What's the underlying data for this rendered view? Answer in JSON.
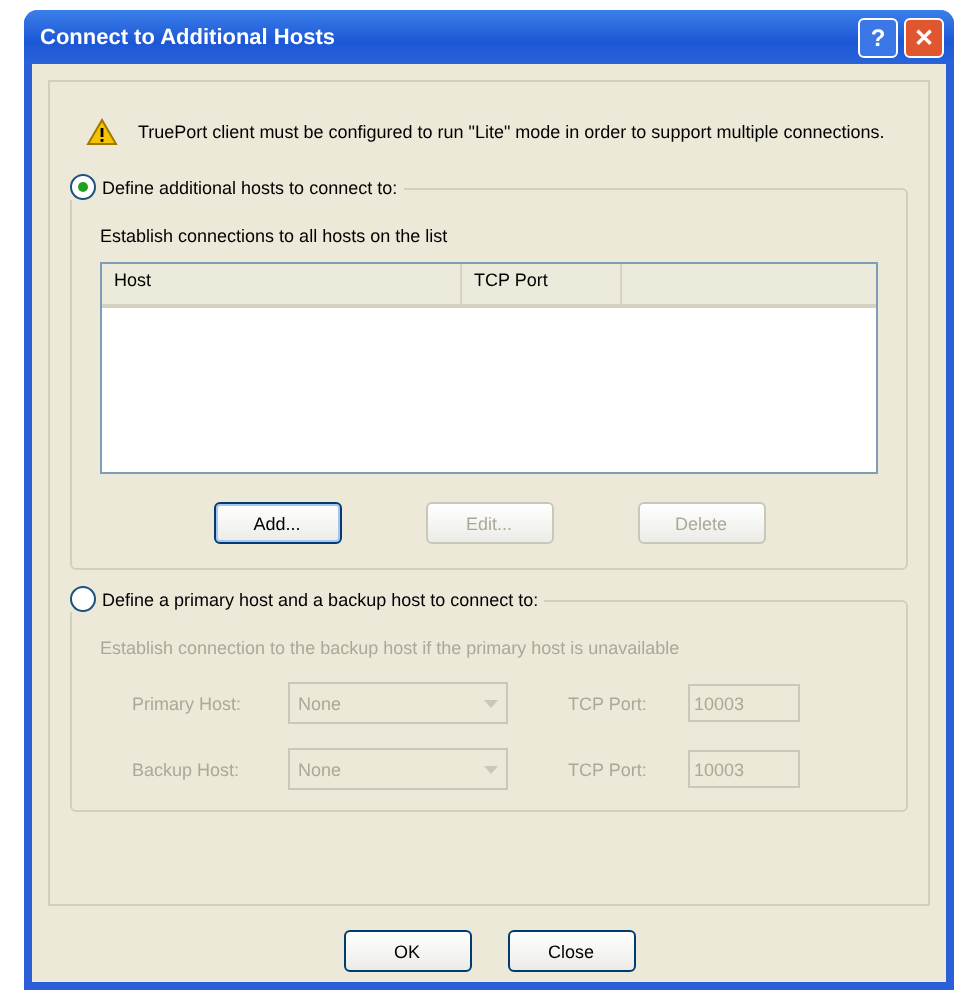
{
  "window": {
    "title": "Connect to Additional Hosts",
    "title_buttons": [
      {
        "kind": "help",
        "label": "?"
      },
      {
        "kind": "close",
        "label": "✕"
      }
    ]
  },
  "warning": "TruePort client must be configured to run \"Lite\" mode in order to support multiple connections.",
  "option_list": {
    "label": "Define additional hosts to connect to:",
    "selected": true,
    "description": "Establish connections to all hosts on the list",
    "columns": [
      "Host",
      "TCP Port"
    ],
    "buttons": [
      {
        "label": "Add...",
        "disabled": false,
        "default": true
      },
      {
        "label": "Edit...",
        "disabled": true,
        "default": false
      },
      {
        "label": "Delete",
        "disabled": true,
        "default": false
      }
    ]
  },
  "option_backup": {
    "label": "Define a primary host and a backup host to connect to:",
    "selected": false,
    "disabled": true,
    "description": "Establish connection to the backup host if the primary host is unavailable",
    "rows": [
      {
        "label": "Primary Host:",
        "host": "None",
        "port_label": "TCP Port:",
        "port": "10003"
      },
      {
        "label": "Backup Host:",
        "host": "None",
        "port_label": "TCP Port:",
        "port": "10003"
      }
    ]
  },
  "buttons": [
    {
      "label": "OK"
    },
    {
      "label": "Close"
    }
  ]
}
